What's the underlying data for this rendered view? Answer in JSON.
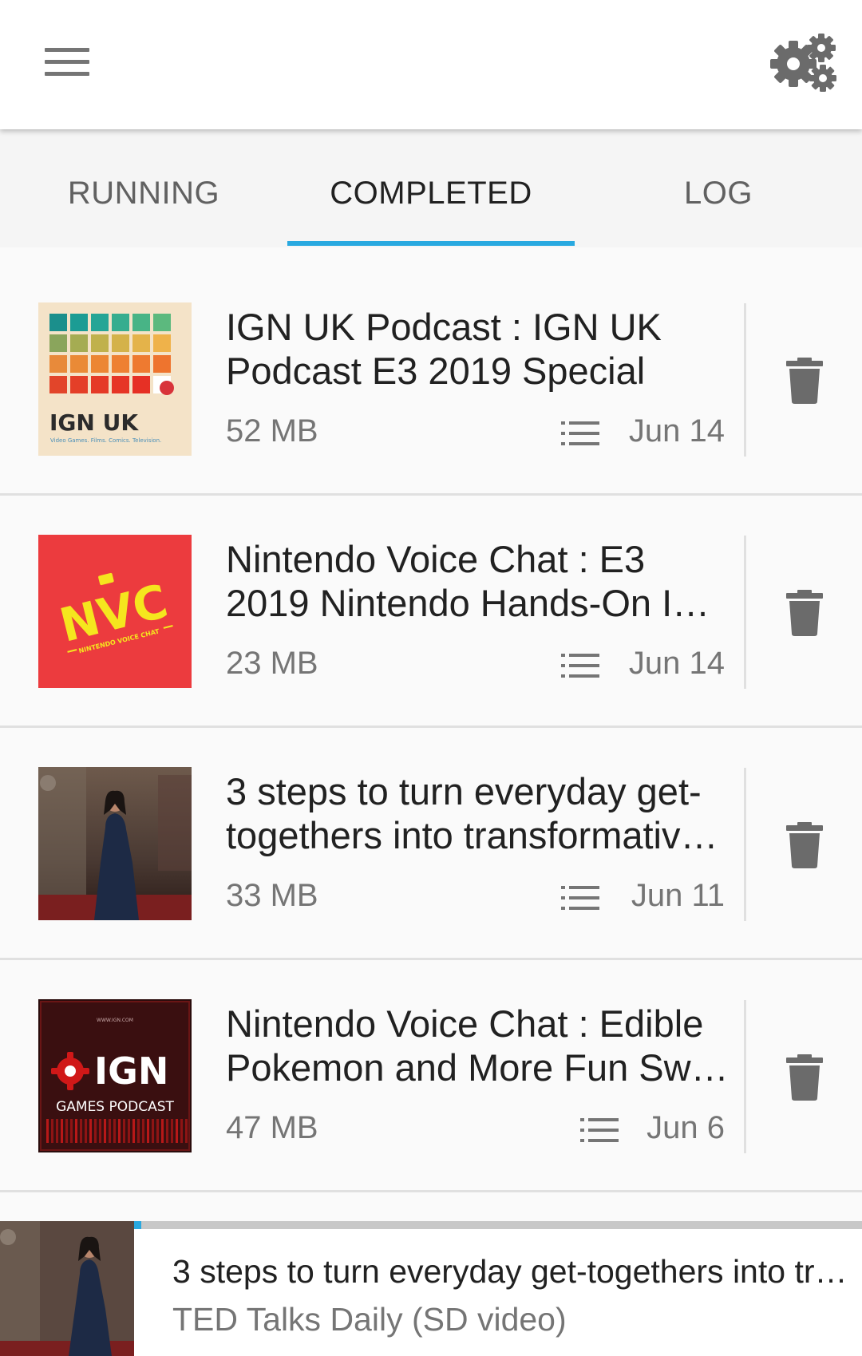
{
  "header": {
    "menu_icon": "hamburger-menu-icon",
    "settings_icon": "gears-icon"
  },
  "tabs": [
    {
      "label": "RUNNING",
      "active": false
    },
    {
      "label": "COMPLETED",
      "active": true
    },
    {
      "label": "LOG",
      "active": false
    }
  ],
  "colors": {
    "accent": "#29a9e0",
    "text_primary": "#212121",
    "text_secondary": "#757575",
    "nvc_red": "#ec3b3e",
    "nvc_yellow": "#f5e61e",
    "ign_red": "#bf1313"
  },
  "downloads": [
    {
      "cover": "ign-uk-podcast-cover",
      "cover_text": "IGN UK",
      "cover_tagline": "Video Games. Films. Comics. Television.",
      "title": "IGN UK Podcast : IGN UK Podcast E3 2019 Special",
      "size": "52 MB",
      "date": "Jun 14"
    },
    {
      "cover": "nintendo-voice-chat-cover",
      "cover_text": "NVC",
      "cover_tagline": "NINTENDO VOICE CHAT",
      "title": "Nintendo Voice Chat : E3 2019 Nintendo Hands-On I…",
      "size": "23 MB",
      "date": "Jun 14"
    },
    {
      "cover": "ted-talk-speaker-cover",
      "title": "3 steps to turn everyday get-togethers into transformativ…",
      "size": "33 MB",
      "date": "Jun 11"
    },
    {
      "cover": "ign-games-podcast-cover",
      "cover_text": "IGN",
      "cover_tagline": "GAMES PODCAST",
      "cover_url": "WWW.IGN.COM",
      "title": "Nintendo Voice Chat : Edible Pokemon and More Fun Sw…",
      "size": "47 MB",
      "date": "Jun 6"
    }
  ],
  "player": {
    "title": "3 steps to turn everyday get-togethers into tr…",
    "subtitle": "TED Talks Daily (SD video)",
    "progress": 0.01
  }
}
